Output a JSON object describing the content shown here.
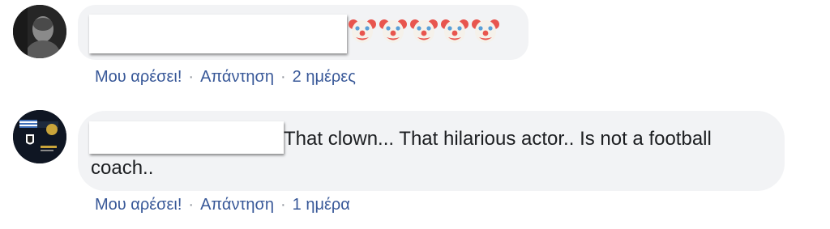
{
  "comments": [
    {
      "like_label": "Μου αρέσει!",
      "reply_label": "Απάντηση",
      "timestamp": "2 ημέρες",
      "separator": "·",
      "emojis": [
        "clown-face-icon",
        "clown-face-icon",
        "clown-face-icon",
        "clown-face-icon",
        "clown-face-icon"
      ]
    },
    {
      "text": "That clown... That hilarious actor.. Is not a football coach..",
      "like_label": "Μου αρέσει!",
      "reply_label": "Απάντηση",
      "timestamp": "1 ημέρα",
      "separator": "·"
    }
  ],
  "colors": {
    "bubble": "#f2f3f5",
    "link": "#385898",
    "meta": "#90949c",
    "text": "#1c1e21"
  }
}
